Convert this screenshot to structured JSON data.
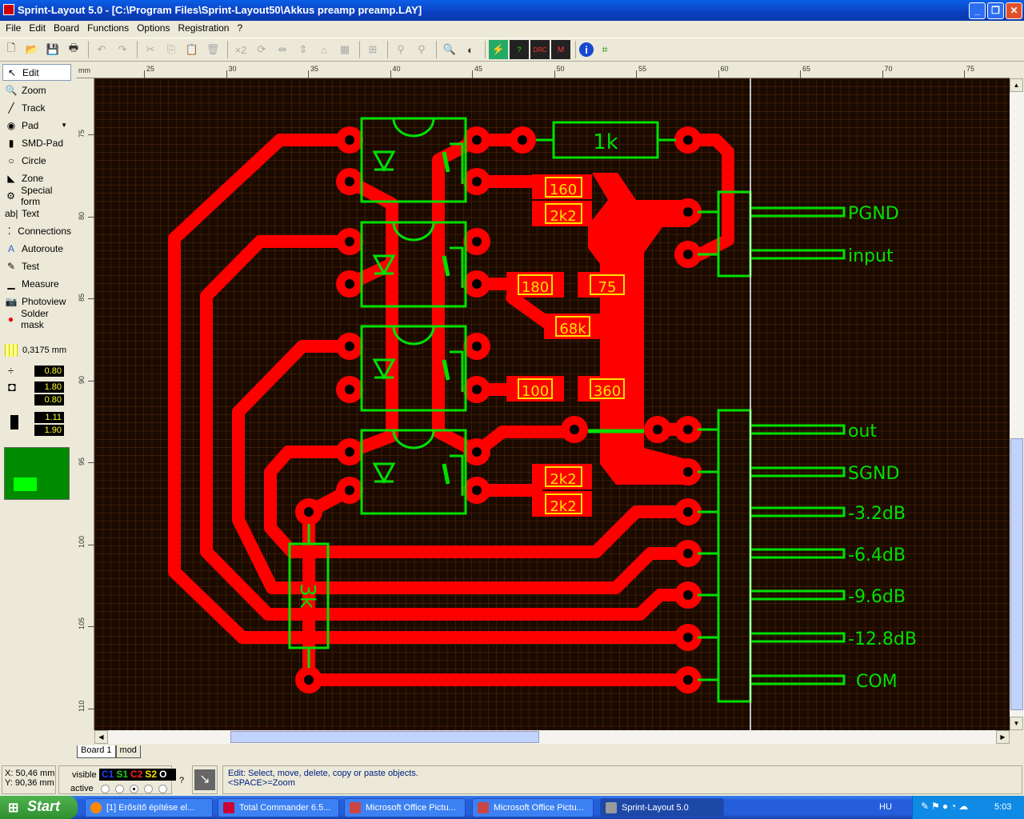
{
  "window": {
    "title": "Sprint-Layout 5.0 - [C:\\Program Files\\Sprint-Layout50\\Akkus preamp preamp.LAY]"
  },
  "menu": [
    "File",
    "Edit",
    "Board",
    "Functions",
    "Options",
    "Registration",
    "?"
  ],
  "tools": [
    {
      "label": "Edit",
      "icon": "arrow-icon",
      "selected": true
    },
    {
      "label": "Zoom",
      "icon": "magnifier-icon"
    },
    {
      "label": "Track",
      "icon": "track-icon"
    },
    {
      "label": "Pad",
      "icon": "pad-icon"
    },
    {
      "label": "SMD-Pad",
      "icon": "smd-pad-icon"
    },
    {
      "label": "Circle",
      "icon": "circle-icon"
    },
    {
      "label": "Zone",
      "icon": "zone-icon"
    },
    {
      "label": "Special form",
      "icon": "special-form-icon"
    },
    {
      "label": "Text",
      "icon": "text-icon"
    },
    {
      "label": "Connections",
      "icon": "connections-icon"
    },
    {
      "label": "Autoroute",
      "icon": "autoroute-icon"
    },
    {
      "label": "Test",
      "icon": "test-icon"
    },
    {
      "label": "Measure",
      "icon": "measure-icon"
    },
    {
      "label": "Photoview",
      "icon": "camera-icon"
    },
    {
      "label": "Solder mask",
      "icon": "solder-mask-icon"
    }
  ],
  "grid": "0,3175 mm",
  "params": {
    "track_width": "0.80",
    "pad_outer": "1.80",
    "pad_inner": "0.80",
    "smd_width": "1.11",
    "smd_height": "1.90"
  },
  "ruler": {
    "unit": "mm",
    "top": [
      "25",
      "30",
      "35",
      "40",
      "45",
      "50",
      "55",
      "60",
      "65",
      "70",
      "75"
    ],
    "left": [
      "75",
      "80",
      "85",
      "90",
      "95",
      "100",
      "105",
      "110"
    ]
  },
  "components": {
    "r_1k": "1k",
    "r_3k": "3k",
    "smd": [
      "160",
      "2k2",
      "180",
      "75",
      "68k",
      "100",
      "360",
      "2k2",
      "2k2"
    ]
  },
  "connector": [
    "PGND",
    "input",
    "out",
    "SGND",
    "-3.2dB",
    "-6.4dB",
    "-9.6dB",
    "-12.8dB",
    "COM"
  ],
  "colors": {
    "copper": "#ff0000",
    "silkscreen": "#00e000",
    "smd_label": "#ffe000",
    "background": "#1a0a00"
  },
  "tabs": [
    "Board 1",
    "mod"
  ],
  "status": {
    "x": "X:  50,46 mm",
    "y": "Y:  90,36 mm",
    "visible_label": "visible",
    "active_label": "active",
    "layers": [
      "C1",
      "S1",
      "C2",
      "S2",
      "O"
    ],
    "active_layer": "C2",
    "help": "?",
    "message1": "Edit: Select, move, delete, copy or paste objects.",
    "message2": "<SPACE>=Zoom"
  },
  "taskbar": {
    "start": "Start",
    "tasks": [
      "[1] Erősítő építése el...",
      "Total Commander 6.5...",
      "Microsoft Office Pictu...",
      "Microsoft Office Pictu...",
      "Sprint-Layout 5.0"
    ],
    "lang": "HU",
    "clock": "5:03"
  }
}
